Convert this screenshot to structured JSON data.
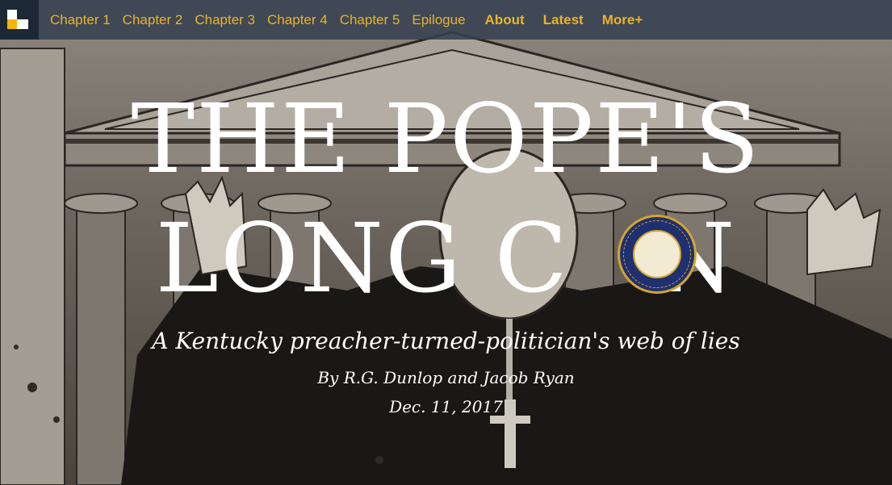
{
  "nav": {
    "items": [
      {
        "label": "Chapter 1"
      },
      {
        "label": "Chapter 2"
      },
      {
        "label": "Chapter 3"
      },
      {
        "label": "Chapter 4"
      },
      {
        "label": "Chapter 5"
      },
      {
        "label": "Epilogue"
      }
    ],
    "about": "About",
    "latest": "Latest",
    "more": "More+"
  },
  "hero": {
    "title_line1": "THE POPE'S",
    "title_line2_a": "LONG C",
    "title_line2_b": "N",
    "subtitle": "A Kentucky preacher-turned-politician's web of lies",
    "byline": "By R.G. Dunlop and Jacob Ryan",
    "date": "Dec. 11, 2017"
  },
  "colors": {
    "nav_bg": "#34404e",
    "nav_link": "#e9b32c",
    "logo_accent": "#f2b705",
    "seal_blue": "#1f3070",
    "seal_gold": "#d4a52a"
  }
}
